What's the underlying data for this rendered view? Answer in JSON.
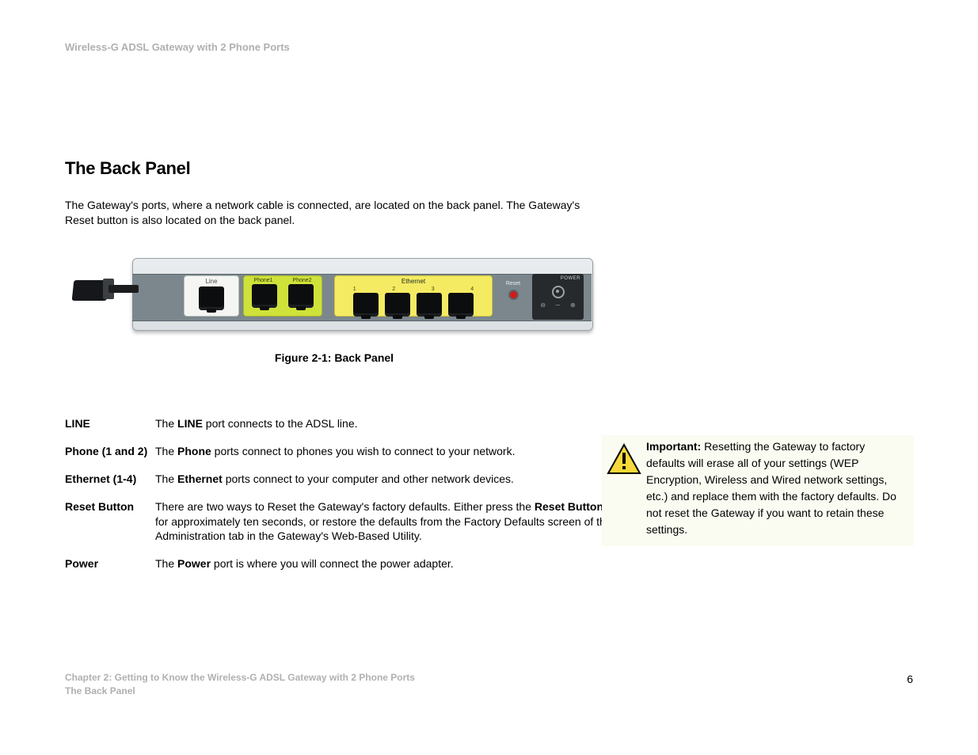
{
  "header": {
    "product": "Wireless-G ADSL Gateway with 2 Phone Ports"
  },
  "section": {
    "title": "The Back Panel",
    "intro": "The Gateway's ports, where a network cable is connected, are located on the back panel. The Gateway's Reset button is also located on the back panel."
  },
  "figure": {
    "caption": "Figure 2-1: Back Panel",
    "labels": {
      "line": "Line",
      "phone1": "Phone1",
      "phone2": "Phone2",
      "ethernet": "Ethernet",
      "e1": "1",
      "e2": "2",
      "e3": "3",
      "e4": "4",
      "reset": "Reset",
      "power": "POWER"
    }
  },
  "definitions": [
    {
      "term": "LINE",
      "pre": "The ",
      "bold": "LINE",
      "post": " port connects to the ADSL line."
    },
    {
      "term": "Phone (1 and 2)",
      "pre": "The ",
      "bold": "Phone",
      "post": " ports connect to phones you wish to connect to your network."
    },
    {
      "term": "Ethernet (1-4)",
      "pre": "The ",
      "bold": "Ethernet",
      "post": " ports connect to your computer and other network devices."
    },
    {
      "term": "Reset Button",
      "pre": "There are two ways to Reset the Gateway's factory defaults. Either press the ",
      "bold": "Reset Button",
      "post": ", for approximately ten seconds, or restore the defaults from the Factory Defaults screen of the Administration tab in the Gateway's Web-Based Utility."
    },
    {
      "term": "Power",
      "pre": "The ",
      "bold": "Power",
      "post": " port is where you will connect the power adapter."
    }
  ],
  "important": {
    "label": "Important:",
    "text": " Resetting the Gateway to factory defaults will erase all of your settings (WEP Encryption, Wireless and Wired network settings, etc.) and replace them with the factory defaults. Do not reset the Gateway if you want to retain these settings."
  },
  "footer": {
    "chapter": "Chapter 2: Getting to Know the Wireless-G ADSL Gateway with 2 Phone Ports",
    "sub": "The Back Panel",
    "page": "6"
  }
}
